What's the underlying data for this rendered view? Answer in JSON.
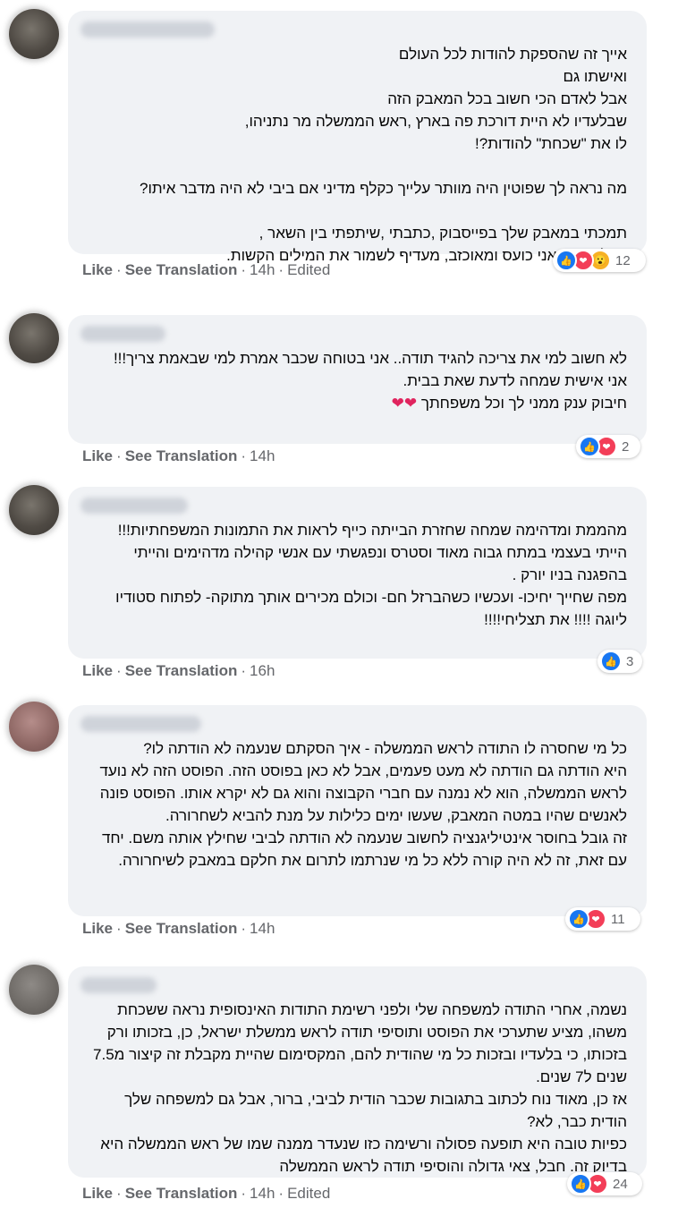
{
  "actions": {
    "like": "Like",
    "see_translation": "See Translation",
    "edited": "Edited",
    "dot": "·"
  },
  "comments": [
    {
      "text": "אייך זה שהספקת להודות לכל העולם\nואישתו גם\nאבל לאדם הכי חשוב בכל המאבק הזה\nשבלעדיו לא היית דורכת פה בארץ ,ראש הממשלה מר נתניהו,\nלו את \"שכחת\" להודות?!\n\nמה נראה לך שפוטין היה מוותר עלייך כקלף מדיני אם ביבי לא היה מדבר איתו?\n\nתמכתי במאבק שלך בפייסבוק ,כתבתי ,שיתפתי בין השאר ,\nאבל עכשיו אני כועס ומאוכזב, מעדיף לשמור את המילים הקשות.",
      "reaction_count": "12",
      "time": "14h",
      "edited": true
    },
    {
      "text": "לא חשוב למי את צריכה להגיד תודה.. אני בטוחה שכבר אמרת למי שבאמת צריך!!!\nאני אישית שמחה לדעת שאת בבית.\nחיבוק ענק ממני לך וכל משפחתך",
      "hearts": "❤❤",
      "reaction_count": "2",
      "time": "14h"
    },
    {
      "text": "מהממת ומדהימה שמחה שחזרת הבייתה כייף לראות את התמונות המשפחתיות!!!\nהייתי בעצמי במתח גבוה מאוד וסטרס ונפגשתי עם אנשי קהילה מדהימים והייתי בהפגנה בניו יורק .\nמפה שחייך יחיכו- ועכשיו כשהברזל חם- וכולם מכירים אותך מתוקה- לפתוח סטודיו ליוגה !!!! את תצליחי!!!!",
      "reaction_count": "3",
      "time": "16h"
    },
    {
      "text": "כל מי שחסרה לו התודה לראש הממשלה - איך הסקתם שנעמה לא הודתה לו?\nהיא הודתה גם הודתה לא מעט פעמים, אבל לא כאן בפוסט הזה. הפוסט הזה לא נועד לראש הממשלה, הוא לא נמנה עם חברי הקבוצה והוא גם לא יקרא אותו. הפוסט פונה לאנשים שהיו במטה המאבק, שעשו ימים כלילות על מנת להביא לשחרורה.\nזה גובל בחוסר אינטיליגנציה לחשוב שנעמה לא הודתה לביבי שחילץ אותה משם. יחד עם זאת, זה לא היה קורה ללא כל מי שנרתמו לתרום את חלקם במאבק לשיחרורה.",
      "reaction_count": "11",
      "time": "14h"
    },
    {
      "text": "נשמה, אחרי התודה למשפחה שלי ולפני רשימת התודות האינסופית נראה ששכחת משהו, מציע שתערכי את הפוסט ותוסיפי תודה לראש ממשלת ישראל, כן, בזכותו ורק בזכותו, כי בלעדיו ובזכות כל מי שהודית להם, המקסימום שהיית מקבלת זה קיצור מ7.5 שנים ל7 שנים.\nאז כן, מאוד נוח לכתוב בתגובות שכבר הודית לביבי, ברור, אבל גם למשפחה שלך הודית כבר, לא?\nכפיות טובה היא תופעה פסולה ורשימה כזו שנעדר ממנה שמו של ראש הממשלה היא בדיוק זה. חבל, צאי גדולה והוסיפי תודה לראש הממשלה",
      "reaction_count": "24",
      "time": "14h",
      "edited": true
    }
  ]
}
